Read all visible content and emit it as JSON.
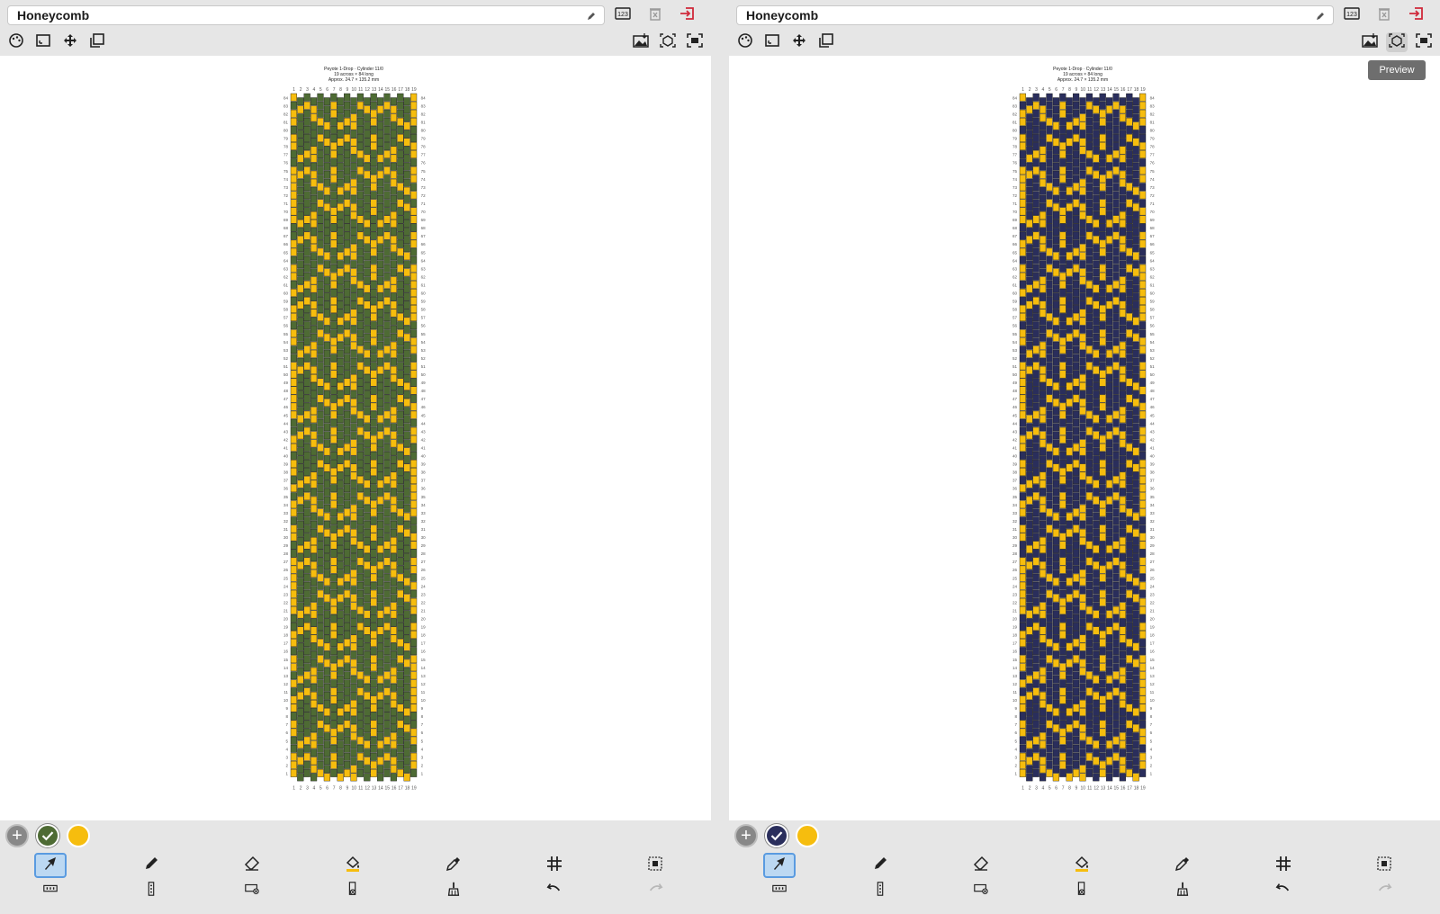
{
  "panels": [
    {
      "title": "Honeycomb",
      "pattern": {
        "header_lines": [
          "Peyote 1-Drop · Cylinder 11/0",
          "19 across × 84 long",
          "Approx. 24.7 × 135.2 mm"
        ],
        "columns": 19,
        "rows": 84,
        "background_color": "#4e6b34",
        "accent_color": "#f6bd0e"
      },
      "palette": [
        {
          "color": "#4e6b34",
          "selected": true
        },
        {
          "color": "#f6bd0e",
          "selected": false
        }
      ],
      "tooltip": ""
    },
    {
      "title": "Honeycomb",
      "pattern": {
        "header_lines": [
          "Peyote 1-Drop · Cylinder 11/0",
          "19 across × 84 long",
          "Approx. 24.7 × 135.2 mm"
        ],
        "columns": 19,
        "rows": 84,
        "background_color": "#2a2e5c",
        "accent_color": "#f6bd0e"
      },
      "palette": [
        {
          "color": "#2a2e5c",
          "selected": true
        },
        {
          "color": "#f6bd0e",
          "selected": false
        }
      ],
      "tooltip": "Preview"
    }
  ],
  "toolbar_icons": {
    "top_left": [
      "palette-icon",
      "resize-icon",
      "move-icon",
      "layers-icon"
    ],
    "top_right": [
      "numbering-icon",
      "delete-icon",
      "exit-icon"
    ],
    "view": [
      "export-image-icon",
      "preview-3d-icon",
      "fit-screen-icon"
    ],
    "tools_row1": [
      "select-arrow-icon",
      "pencil-icon",
      "eraser-icon",
      "fill-bucket-icon",
      "eyedropper-icon",
      "grid-icon",
      "selection-box-icon"
    ],
    "tools_row2": [
      "row-insert-icon",
      "column-insert-icon",
      "delete-row-icon",
      "delete-column-icon",
      "broom-icon",
      "undo-icon",
      "redo-icon"
    ]
  },
  "colors": {
    "chrome": "#e6e6e6",
    "exit_red": "#d0283a",
    "active_tool": "#bcd8f2"
  }
}
